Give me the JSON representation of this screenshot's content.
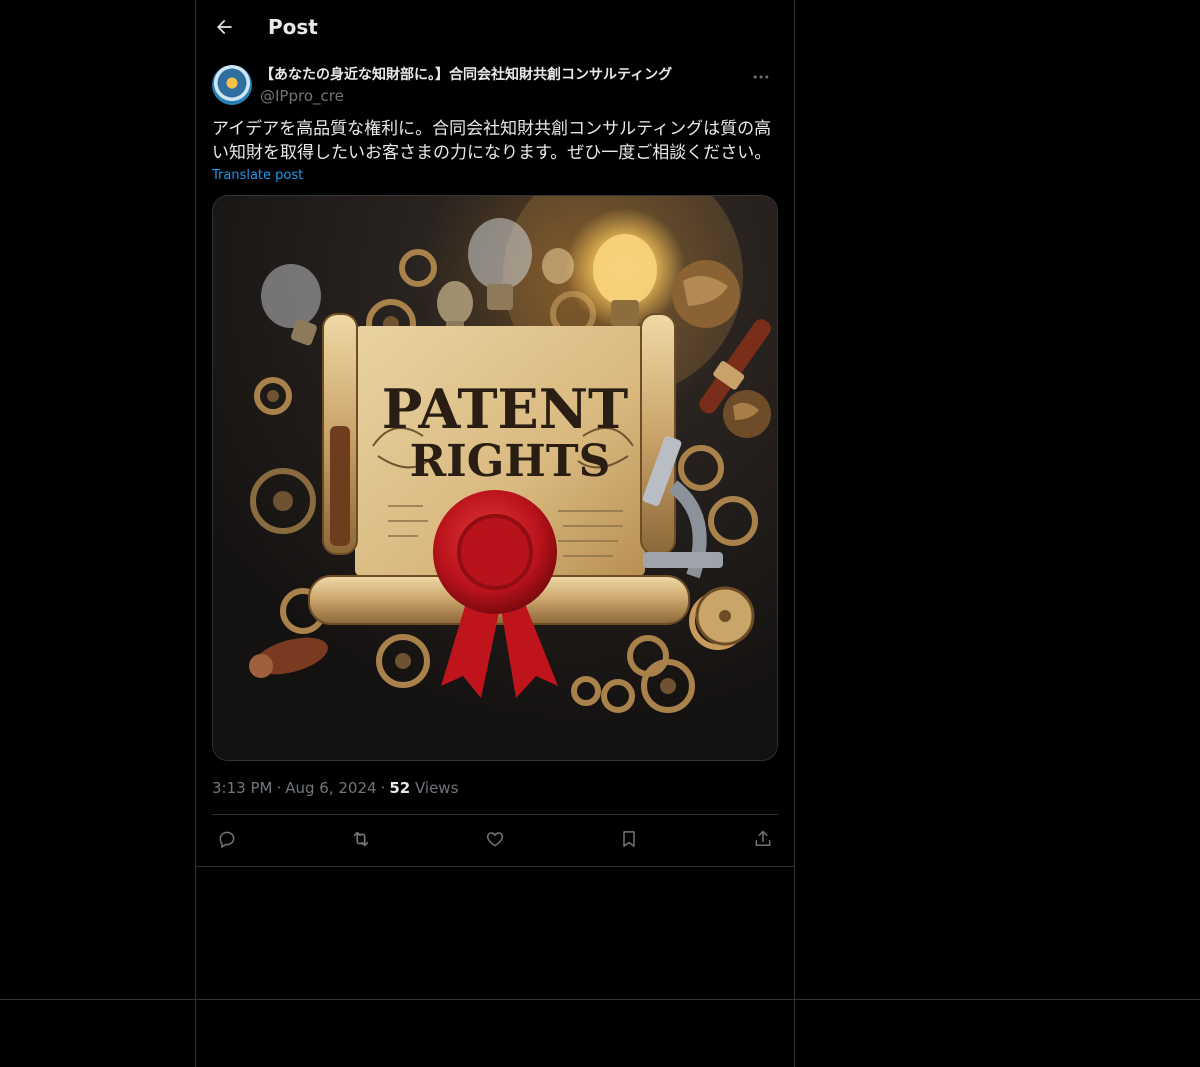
{
  "header": {
    "title": "Post",
    "back_icon": "arrow-left-icon"
  },
  "post": {
    "author": {
      "display_name": "【あなたの身近な知財部に。】合同会社知財共創コンサルティング",
      "handle": "@IPpro_cre",
      "avatar_icon": "lightbulb-gear-avatar"
    },
    "text": "アイデアを高品質な権利に。合同会社知財共創コンサルティングは質の高い知財を取得したいお客さまの力になります。ぜひ一度ご相談ください。",
    "translate_label": "Translate post",
    "image": {
      "headline_line1": "PATENT",
      "headline_line2": "RIGHTS"
    },
    "time": "3:13 PM",
    "date": "Aug 6, 2024",
    "separator": "·",
    "views_count": "52",
    "views_label": "Views",
    "actions": [
      "reply-icon",
      "repost-icon",
      "like-icon",
      "bookmark-icon",
      "share-icon"
    ]
  },
  "colors": {
    "background": "#000000",
    "text_primary": "#e7e9ea",
    "text_secondary": "#71767b",
    "link": "#1d9bf0",
    "border": "#2f3336",
    "seal_red": "#c0141c"
  }
}
